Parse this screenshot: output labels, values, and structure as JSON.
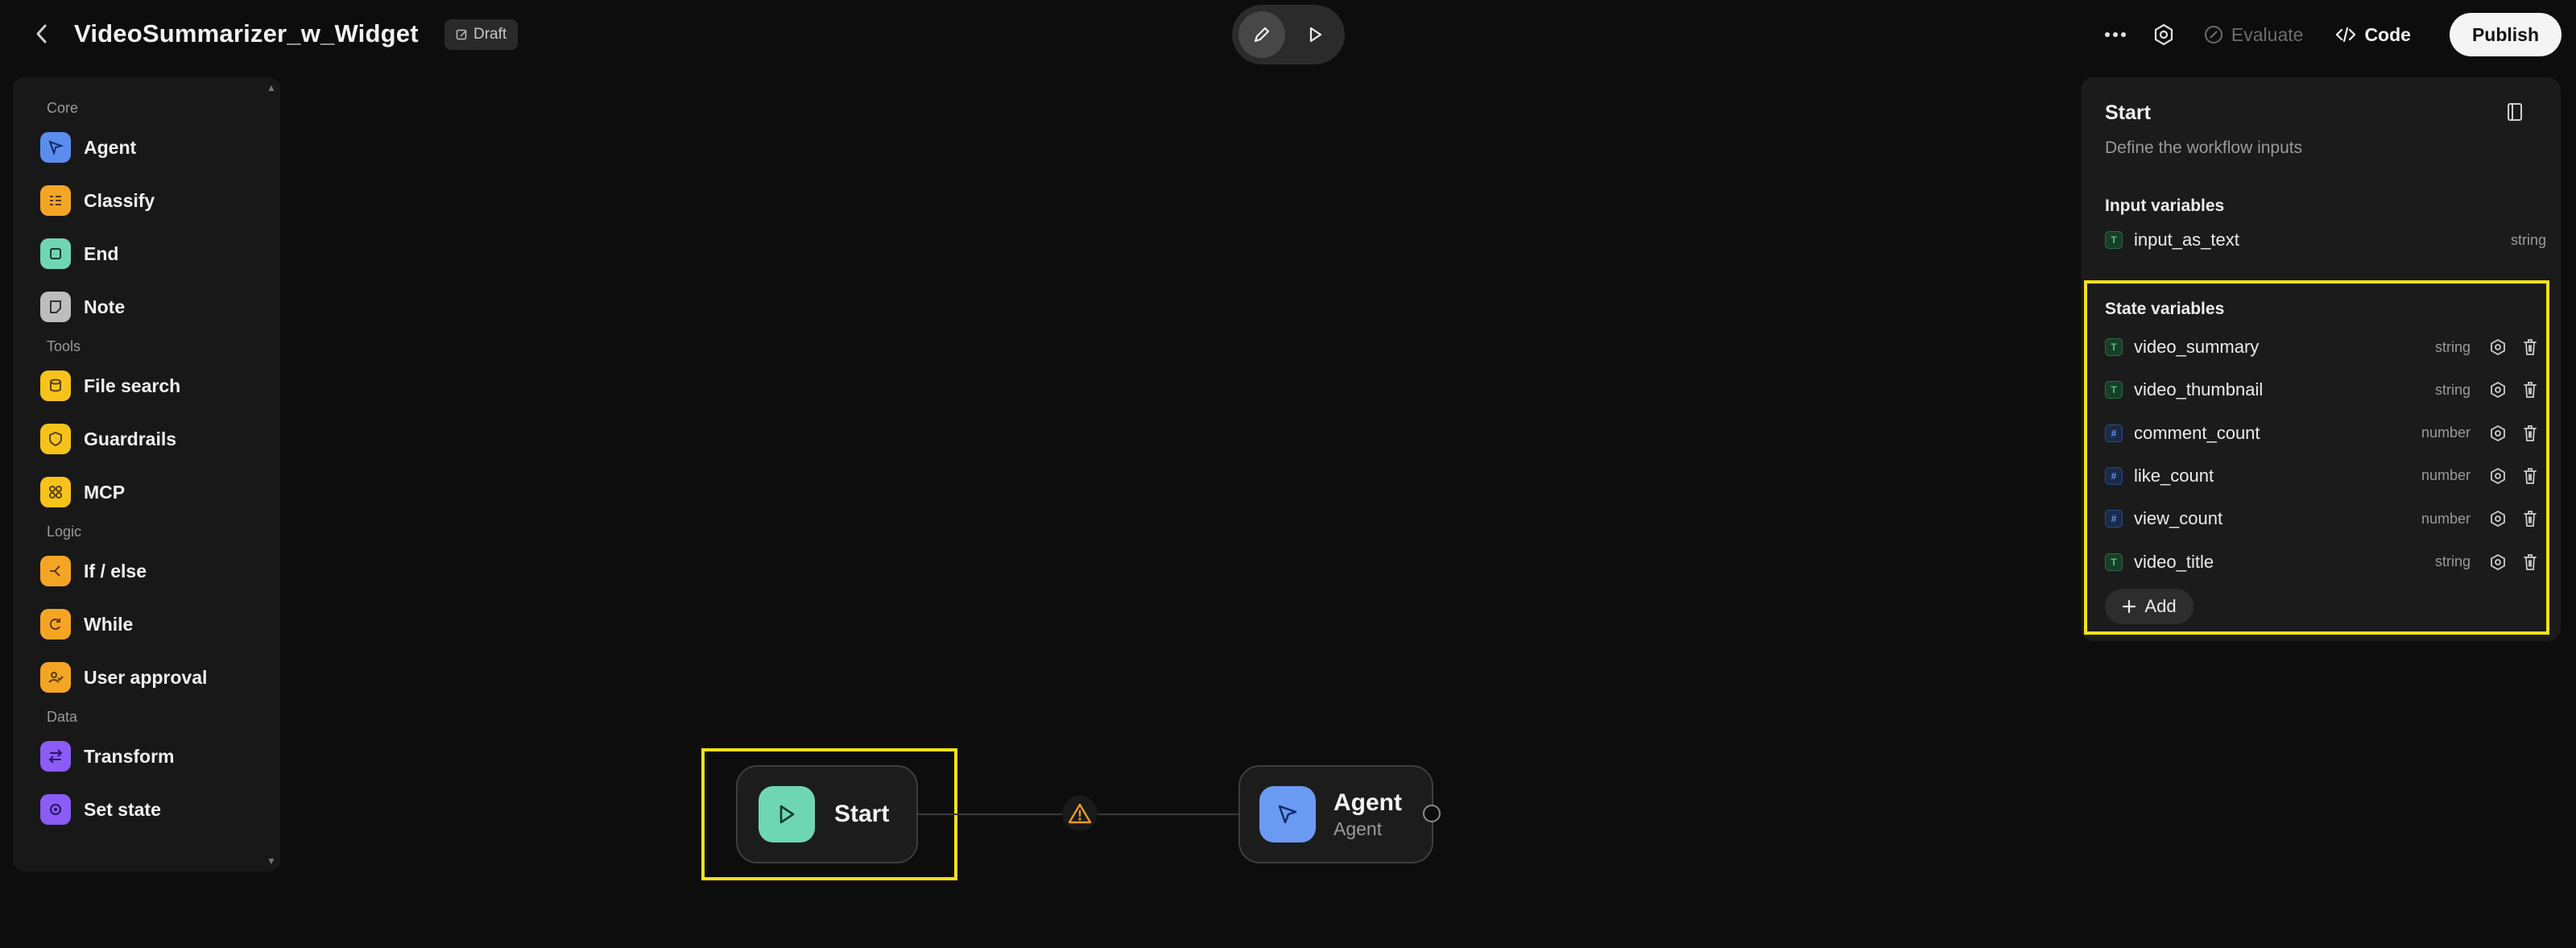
{
  "header": {
    "title": "VideoSummarizer_w_Widget",
    "badge": "Draft",
    "evaluate_label": "Evaluate",
    "code_label": "Code",
    "publish_label": "Publish"
  },
  "palette": {
    "sections": [
      {
        "title": "Core",
        "items": [
          {
            "label": "Agent",
            "color": "#5b8def",
            "icon": "agent-icon"
          },
          {
            "label": "Classify",
            "color": "#f5a524",
            "icon": "classify-icon"
          },
          {
            "label": "End",
            "color": "#6fd6b3",
            "icon": "end-icon"
          },
          {
            "label": "Note",
            "color": "#bdbdbd",
            "icon": "note-icon"
          }
        ]
      },
      {
        "title": "Tools",
        "items": [
          {
            "label": "File search",
            "color": "#f7c31a",
            "icon": "file-search-icon"
          },
          {
            "label": "Guardrails",
            "color": "#f7c31a",
            "icon": "guardrails-icon"
          },
          {
            "label": "MCP",
            "color": "#f7c31a",
            "icon": "mcp-icon"
          }
        ]
      },
      {
        "title": "Logic",
        "items": [
          {
            "label": "If / else",
            "color": "#f5a524",
            "icon": "if-else-icon"
          },
          {
            "label": "While",
            "color": "#f5a524",
            "icon": "while-icon"
          },
          {
            "label": "User approval",
            "color": "#f5a524",
            "icon": "user-approval-icon"
          }
        ]
      },
      {
        "title": "Data",
        "items": [
          {
            "label": "Transform",
            "color": "#8b5cf6",
            "icon": "transform-icon"
          },
          {
            "label": "Set state",
            "color": "#8b5cf6",
            "icon": "set-state-icon"
          }
        ]
      }
    ]
  },
  "canvas": {
    "start_node": {
      "label": "Start",
      "color": "#6fd6b3"
    },
    "agent_node": {
      "label": "Agent",
      "sublabel": "Agent",
      "color": "#6b9af2"
    },
    "highlight_color": "#f7e01a"
  },
  "inspector": {
    "title": "Start",
    "subtitle": "Define the workflow inputs",
    "input_label": "Input variables",
    "input_vars": [
      {
        "name": "input_as_text",
        "type": "string"
      }
    ],
    "state_label": "State variables",
    "state_vars": [
      {
        "name": "video_summary",
        "type": "string"
      },
      {
        "name": "video_thumbnail",
        "type": "string"
      },
      {
        "name": "comment_count",
        "type": "number"
      },
      {
        "name": "like_count",
        "type": "number"
      },
      {
        "name": "view_count",
        "type": "number"
      },
      {
        "name": "video_title",
        "type": "string"
      }
    ],
    "add_label": "Add"
  }
}
